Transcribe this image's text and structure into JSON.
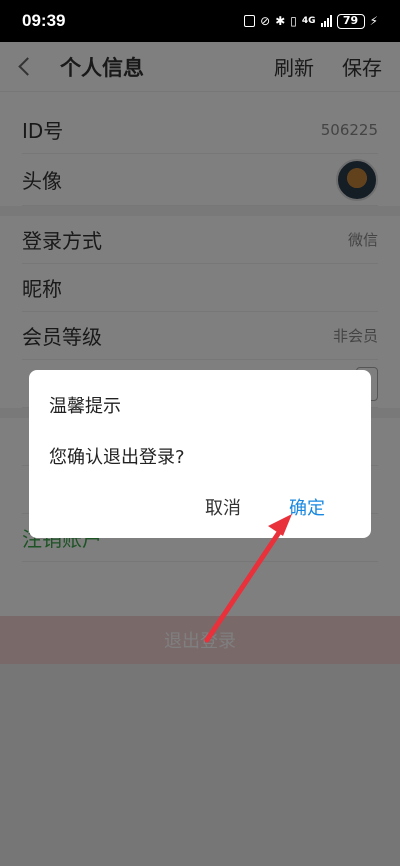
{
  "status": {
    "time": "09:39",
    "network": "4G",
    "battery": "79"
  },
  "header": {
    "title": "个人信息",
    "refresh": "刷新",
    "save": "保存"
  },
  "rows": {
    "id_label": "ID号",
    "id_value": "506225",
    "avatar_label": "头像",
    "login_method_label": "登录方式",
    "login_method_value": "微信",
    "nickname_label": "昵称",
    "member_level_label": "会员等级",
    "member_level_value": "非会员",
    "cancel_account": "注销账户"
  },
  "logout_button": "退出登录",
  "dialog": {
    "title": "温馨提示",
    "message": "您确认退出登录?",
    "cancel": "取消",
    "confirm": "确定"
  },
  "colors": {
    "confirm": "#1a88e0",
    "arrow": "#e8313a",
    "cancel_account": "#3aa64a"
  }
}
